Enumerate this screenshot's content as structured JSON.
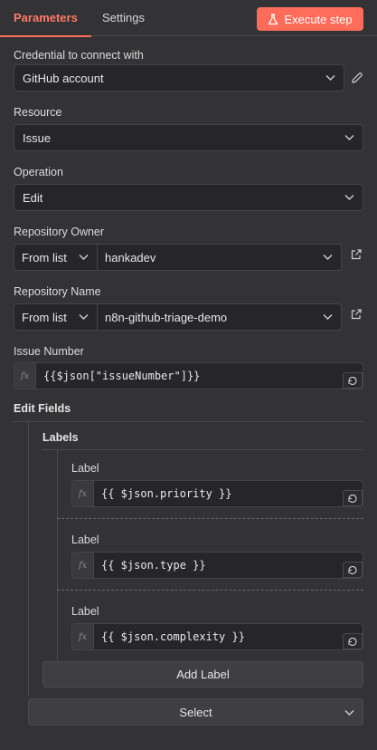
{
  "tabs": [
    {
      "label": "Parameters",
      "active": true
    },
    {
      "label": "Settings",
      "active": false
    }
  ],
  "execute_button": {
    "label": "Execute step",
    "icon": "flask-icon"
  },
  "credential": {
    "label": "Credential to connect with",
    "value": "GitHub account",
    "icon": "pencil-icon"
  },
  "resource": {
    "label": "Resource",
    "value": "Issue"
  },
  "operation": {
    "label": "Operation",
    "value": "Edit"
  },
  "repository_owner": {
    "label": "Repository Owner",
    "mode": "From list",
    "value": "hankadev",
    "icon": "external-link-icon"
  },
  "repository_name": {
    "label": "Repository Name",
    "mode": "From list",
    "value": "n8n-github-triage-demo",
    "icon": "external-link-icon"
  },
  "issue_number": {
    "label": "Issue Number",
    "value": "{{$json[\"issueNumber\"]}}",
    "prefix": "fx"
  },
  "edit_fields": {
    "label": "Edit Fields",
    "labels_group": {
      "label": "Labels",
      "items": [
        {
          "label": "Label",
          "value": "{{ $json.priority }}"
        },
        {
          "label": "Label",
          "value": "{{ $json.type }}"
        },
        {
          "label": "Label",
          "value": "{{ $json.complexity }}"
        }
      ],
      "add_button": "Add Label"
    },
    "select_placeholder": "Select"
  },
  "colors": {
    "accent": "#ff6d5a",
    "background": "#333336",
    "input": "#26262a"
  }
}
